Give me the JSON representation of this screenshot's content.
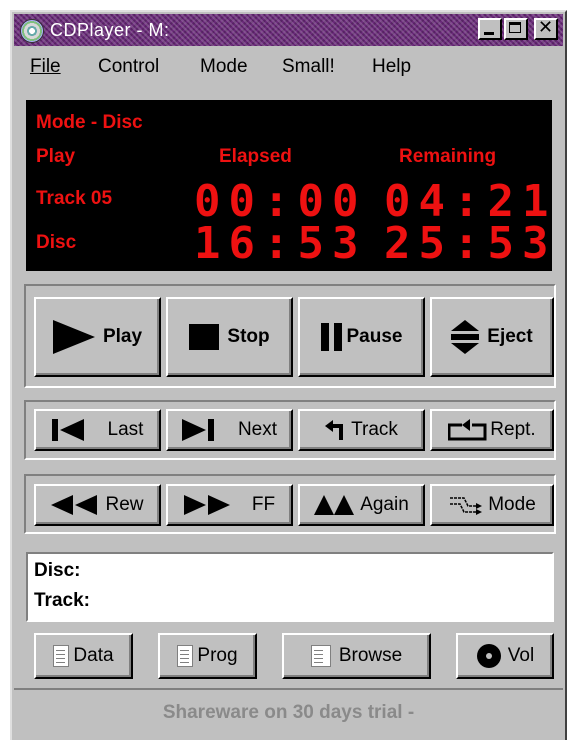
{
  "window": {
    "title": "CDPlayer - M:"
  },
  "menu": {
    "file": "File",
    "control": "Control",
    "mode": "Mode",
    "small": "Small!",
    "help": "Help"
  },
  "display": {
    "mode_label": "Mode - Disc",
    "state": "Play",
    "elapsed_header": "Elapsed",
    "remaining_header": "Remaining",
    "track_label": "Track 05",
    "disc_label": "Disc",
    "track_elapsed": "00:00",
    "track_remaining": "04:21",
    "disc_elapsed": "16:53",
    "disc_remaining": "25:53",
    "color": "#ee1111"
  },
  "transport": {
    "play": "Play",
    "stop": "Stop",
    "pause": "Pause",
    "eject": "Eject"
  },
  "navigation": {
    "last": "Last",
    "next": "Next",
    "track": "Track",
    "repeat": "Rept."
  },
  "seek": {
    "rewind": "Rew",
    "ff": "FF",
    "again": "Again",
    "mode": "Mode"
  },
  "info": {
    "disc": "Disc:",
    "track": "Track:"
  },
  "bottom": {
    "data": "Data",
    "prog": "Prog",
    "browse": "Browse",
    "vol": "Vol"
  },
  "status": "Shareware on 30 days trial -"
}
